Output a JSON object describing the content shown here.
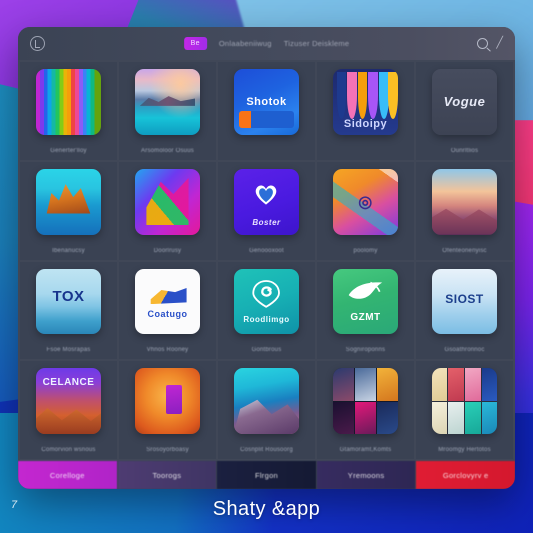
{
  "footer": {
    "brand": "Shaty &app",
    "page_number": "7"
  },
  "window": {
    "titlebar": {
      "logo_icon": "circle-logo-icon",
      "nav_pill": "Be",
      "nav_items": [
        "Onlaabeniiwug",
        "Tizuser Deiskleme"
      ],
      "search_icon": "search-icon",
      "user_icon": "user-icon"
    },
    "grid": {
      "cells": [
        {
          "caption": "Generter'lloy",
          "art": "art-stripes",
          "label": ""
        },
        {
          "caption": "Arsomoloor Osuus",
          "art": "art-lake",
          "label": ""
        },
        {
          "caption": "",
          "art": "art-shotok",
          "label": "Shotok"
        },
        {
          "caption": "",
          "art": "art-curtain",
          "label": "Sidoipy"
        },
        {
          "caption": "Ounrltlios",
          "art": "art-vogue",
          "label": "Vogue"
        },
        {
          "caption": "Ibenanucsy",
          "art": "art-island",
          "label": ""
        },
        {
          "caption": "Doorlrusy",
          "art": "art-prism",
          "label": ""
        },
        {
          "caption": "Genoooxoot",
          "art": "art-heart",
          "label": "Boster"
        },
        {
          "caption": "poolomy",
          "art": "art-fan",
          "label": ""
        },
        {
          "caption": "Ofenteonenyisc",
          "art": "art-dune",
          "label": ""
        },
        {
          "caption": "Fsoe Mosrapas",
          "art": "art-tox",
          "label": "TOX"
        },
        {
          "caption": "Vhnos Rooney",
          "art": "art-white",
          "label": "Coatugo"
        },
        {
          "caption": "Gontbrous",
          "art": "art-teal",
          "label": "Roodlimgo"
        },
        {
          "caption": "Sogniroponns",
          "art": "art-green",
          "label": "GZMT"
        },
        {
          "caption": "Gsoathronnoc",
          "art": "art-sky",
          "label": "SIOST"
        },
        {
          "caption": "Comorvion wsnous",
          "art": "art-celance",
          "label": "CELANCE"
        },
        {
          "caption": "Srosoyorboasy",
          "art": "art-orange",
          "label": ""
        },
        {
          "caption": "Cosnplit Rousoorg",
          "art": "art-coast",
          "label": ""
        },
        {
          "caption": "Gtamoramt,Komts",
          "art": "art-collage",
          "label": ""
        },
        {
          "caption": "Mroomgy Hertotos",
          "art": "art-money",
          "label": ""
        }
      ]
    },
    "tabbar": {
      "tabs": [
        {
          "label": "Corelloge",
          "color": "#c427d0"
        },
        {
          "label": "Toorogs",
          "color": "#4a3a6e"
        },
        {
          "label": "Flrgon",
          "color": "#1a1f3c"
        },
        {
          "label": "Yremoons",
          "color": "#332a5e"
        },
        {
          "label": "Gorclovyrv e",
          "color": "#e11d34"
        }
      ]
    }
  },
  "colors": {
    "window_bg": "#3a4252",
    "titlebar_bg": "#434a5c",
    "accent_magenta": "#c427d0",
    "accent_red": "#e11d34"
  }
}
